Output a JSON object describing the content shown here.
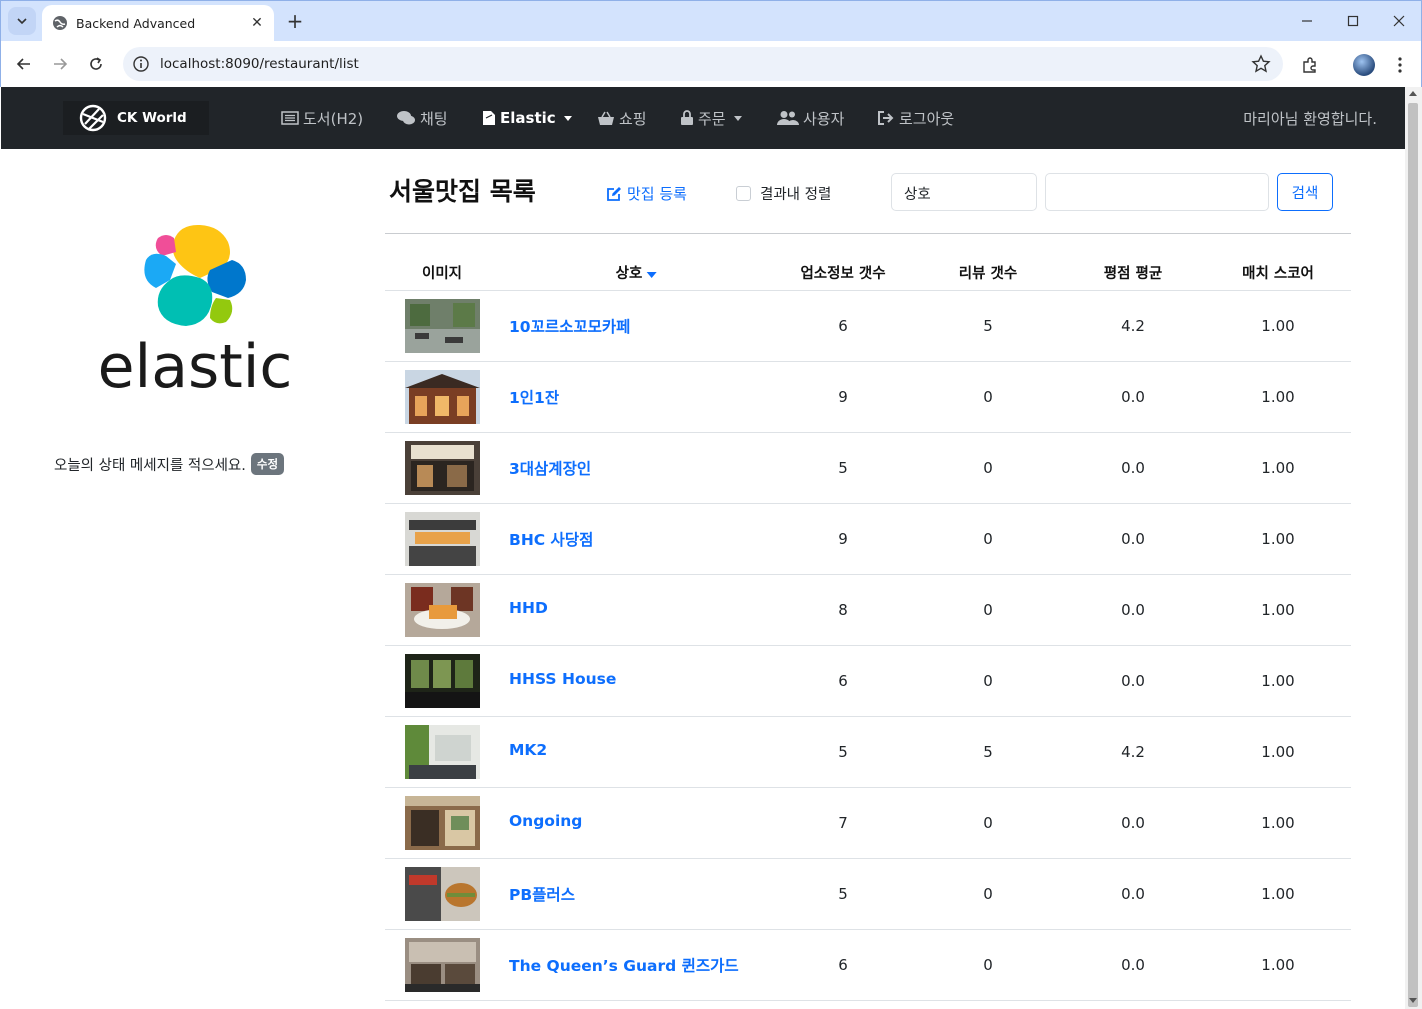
{
  "browser": {
    "tab_title": "Backend Advanced",
    "url": "localhost:8090/restaurant/list"
  },
  "navbar": {
    "brand": "CK World",
    "items": [
      {
        "label": "도서(H2)",
        "icon": "list-icon"
      },
      {
        "label": "채팅",
        "icon": "chat-icon"
      },
      {
        "label": "Elastic",
        "icon": "document-icon",
        "dropdown": true,
        "active": true
      },
      {
        "label": "쇼핑",
        "icon": "basket-icon"
      },
      {
        "label": "주문",
        "icon": "lock-icon",
        "dropdown": true
      },
      {
        "label": "사용자",
        "icon": "users-icon"
      },
      {
        "label": "로그아웃",
        "icon": "logout-icon"
      }
    ],
    "welcome": "마리아님 환영합니다."
  },
  "sidebar": {
    "logo_text": "elastic",
    "status_message": "오늘의 상태 메세지를 적으세요.",
    "edit_badge": "수정"
  },
  "main": {
    "title": "서울맛집 목록",
    "add_link": "맛집 등록",
    "checkbox_label": "결과내 정렬",
    "select_value": "상호",
    "search_value": "",
    "search_button": "검색"
  },
  "table": {
    "headers": [
      "이미지",
      "상호",
      "업소정보 갯수",
      "리뷰 갯수",
      "평점 평균",
      "매치 스코어"
    ],
    "sorted_column": "상호",
    "rows": [
      {
        "name": "10꼬르소꼬모카페",
        "info": "6",
        "reviews": "5",
        "rating": "4.2",
        "score": "1.00"
      },
      {
        "name": "1인1잔",
        "info": "9",
        "reviews": "0",
        "rating": "0.0",
        "score": "1.00"
      },
      {
        "name": "3대삼계장인",
        "info": "5",
        "reviews": "0",
        "rating": "0.0",
        "score": "1.00"
      },
      {
        "name": "BHC 사당점",
        "info": "9",
        "reviews": "0",
        "rating": "0.0",
        "score": "1.00"
      },
      {
        "name": "HHD",
        "info": "8",
        "reviews": "0",
        "rating": "0.0",
        "score": "1.00"
      },
      {
        "name": "HHSS House",
        "info": "6",
        "reviews": "0",
        "rating": "0.0",
        "score": "1.00"
      },
      {
        "name": "MK2",
        "info": "5",
        "reviews": "5",
        "rating": "4.2",
        "score": "1.00"
      },
      {
        "name": "Ongoing",
        "info": "7",
        "reviews": "0",
        "rating": "0.0",
        "score": "1.00"
      },
      {
        "name": "PB플러스",
        "info": "5",
        "reviews": "0",
        "rating": "0.0",
        "score": "1.00"
      },
      {
        "name": "The Queen’s Guard 퀸즈가드",
        "info": "6",
        "reviews": "0",
        "rating": "0.0",
        "score": "1.00"
      }
    ]
  },
  "colors": {
    "navbar_bg": "#212529",
    "link": "#0d6efd",
    "chrome_bg": "#d3e3fd"
  }
}
